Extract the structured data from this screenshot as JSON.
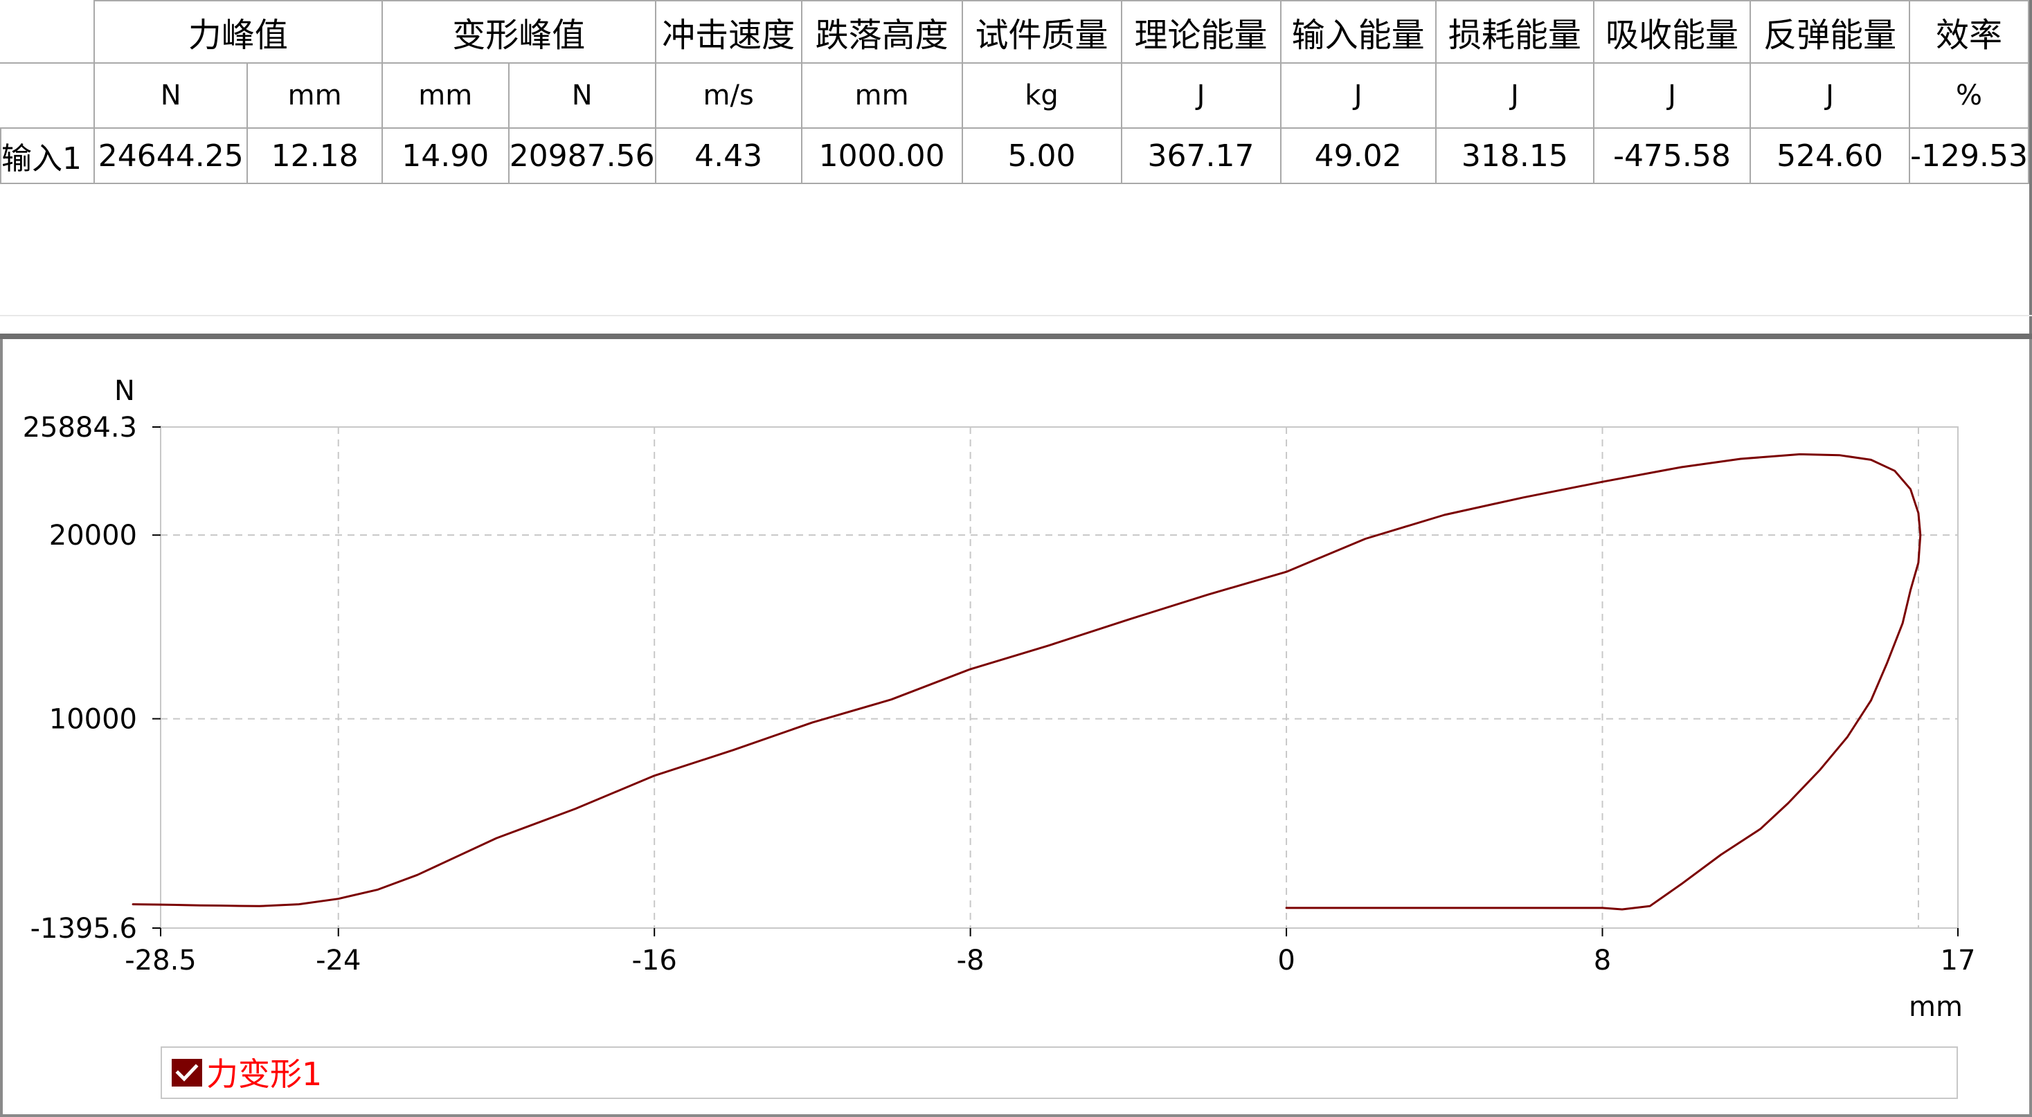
{
  "table": {
    "header_top": [
      "",
      "力峰值",
      "变形峰值",
      "冲击速度",
      "跌落高度",
      "试件质量",
      "理论能量",
      "输入能量",
      "损耗能量",
      "吸收能量",
      "反弹能量",
      "效率"
    ],
    "header_units": [
      "",
      "N",
      "mm",
      "mm",
      "N",
      "m/s",
      "mm",
      "kg",
      "J",
      "J",
      "J",
      "J",
      "J",
      "%"
    ],
    "rows": [
      {
        "label": "输入1",
        "values": [
          "24644.25",
          "12.18",
          "14.90",
          "20987.56",
          "4.43",
          "1000.00",
          "5.00",
          "367.17",
          "49.02",
          "318.15",
          "-475.58",
          "524.60",
          "-129.53"
        ]
      }
    ]
  },
  "chart_data": {
    "type": "line",
    "ylabel": "N",
    "xlabel": "mm",
    "xlim": [
      -28.5,
      17
    ],
    "ylim": [
      -1395.6,
      25884.3
    ],
    "x_ticks": [
      "-28.5",
      "-24",
      "-16",
      "-8",
      "0",
      "8",
      "17"
    ],
    "y_ticks": [
      "-1395.6",
      "10000",
      "20000",
      "25884.3"
    ],
    "x_tick_values": [
      -28.5,
      -24,
      -16,
      -8,
      0,
      8,
      17
    ],
    "y_tick_values": [
      -1395.6,
      10000,
      20000,
      25884.3
    ],
    "x_grid": [
      -24,
      -16,
      -8,
      0,
      8,
      16
    ],
    "y_grid": [
      10000,
      20000
    ],
    "grid": true,
    "legend_position": "bottom",
    "series": [
      {
        "name": "力变形1",
        "color": "#7b0000",
        "points": [
          [
            0,
            -300
          ],
          [
            4,
            -300
          ],
          [
            8,
            -300
          ],
          [
            8.5,
            -380
          ],
          [
            9.2,
            -200
          ],
          [
            10,
            1000
          ],
          [
            11,
            2600
          ],
          [
            12,
            4000
          ],
          [
            12.7,
            5400
          ],
          [
            13.5,
            7200
          ],
          [
            14.2,
            9000
          ],
          [
            14.8,
            11000
          ],
          [
            15.2,
            13000
          ],
          [
            15.6,
            15200
          ],
          [
            15.8,
            17000
          ],
          [
            16,
            18500
          ],
          [
            16.05,
            20000
          ],
          [
            16,
            21200
          ],
          [
            15.8,
            22500
          ],
          [
            15.4,
            23500
          ],
          [
            14.8,
            24100
          ],
          [
            14,
            24350
          ],
          [
            13,
            24400
          ],
          [
            11.5,
            24150
          ],
          [
            10,
            23700
          ],
          [
            8,
            22900
          ],
          [
            6,
            22050
          ],
          [
            4,
            21100
          ],
          [
            2,
            19800
          ],
          [
            0,
            18000
          ],
          [
            -2,
            16750
          ],
          [
            -4,
            15400
          ],
          [
            -6,
            14000
          ],
          [
            -8,
            12700
          ],
          [
            -10,
            11050
          ],
          [
            -12,
            9800
          ],
          [
            -14,
            8300
          ],
          [
            -16,
            6900
          ],
          [
            -18,
            5100
          ],
          [
            -20,
            3500
          ],
          [
            -22,
            1500
          ],
          [
            -23,
            700
          ],
          [
            -24,
            200
          ],
          [
            -25,
            -100
          ],
          [
            -26,
            -200
          ],
          [
            -26.5,
            -190
          ],
          [
            -27,
            -170
          ],
          [
            -27.5,
            -160
          ],
          [
            -28.5,
            -120
          ],
          [
            -29.2,
            -100
          ]
        ]
      }
    ]
  },
  "colors": {
    "curve": "#7b0000",
    "legend_text": "#ff0000",
    "checkbox_fill": "#7b0000",
    "grid": "#c8c8c8"
  },
  "legend": {
    "label": "力变形1",
    "checked": true,
    "icon": "check-icon"
  }
}
